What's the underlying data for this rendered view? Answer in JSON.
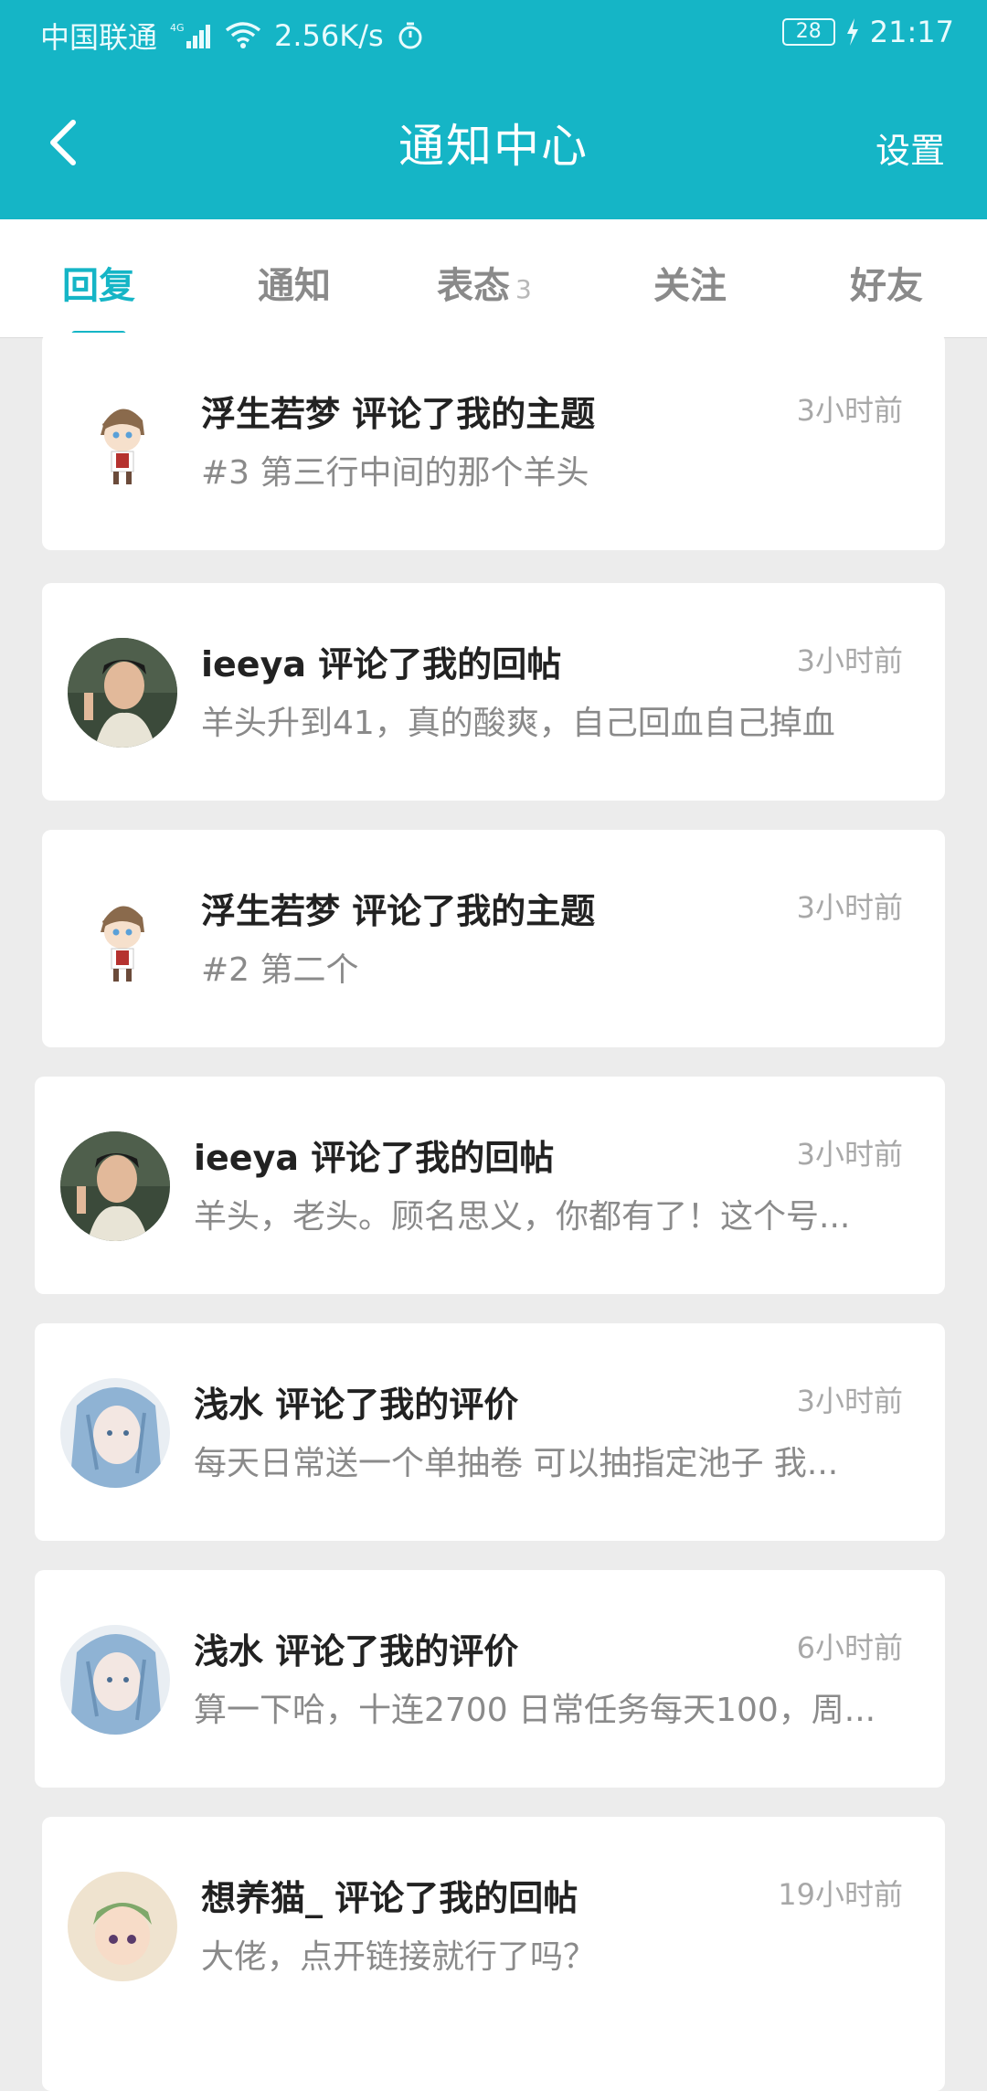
{
  "status_bar": {
    "carrier": "中国联通",
    "network": "4G",
    "speed": "2.56K/s",
    "battery": "28",
    "time": "21:17"
  },
  "header": {
    "title": "通知中心",
    "settings_label": "设置"
  },
  "tabs": [
    {
      "label": "回复",
      "badge": ""
    },
    {
      "label": "通知",
      "badge": ""
    },
    {
      "label": "表态",
      "badge": "3"
    },
    {
      "label": "关注",
      "badge": ""
    },
    {
      "label": "好友",
      "badge": ""
    }
  ],
  "notifications": [
    {
      "title": "浮生若梦 评论了我的主题",
      "snippet": "#3 第三行中间的那个羊头",
      "time": "3小时前",
      "avatar": "chibi-character-avatar"
    },
    {
      "title": "ieeya 评论了我的回帖",
      "snippet": "羊头升到41，真的酸爽，自己回血自己掉血",
      "time": "3小时前",
      "avatar": "man-photo-avatar"
    },
    {
      "title": "浮生若梦 评论了我的主题",
      "snippet": "#2 第二个",
      "time": "3小时前",
      "avatar": "chibi-character-avatar"
    },
    {
      "title": "ieeya 评论了我的回帖",
      "snippet": "羊头，老头。顾名思义，你都有了！这个号...",
      "time": "3小时前",
      "avatar": "man-photo-avatar"
    },
    {
      "title": "浅水 评论了我的评价",
      "snippet": "每天日常送一个单抽卷 可以抽指定池子 我...",
      "time": "3小时前",
      "avatar": "anime-blue-hair-avatar"
    },
    {
      "title": "浅水 评论了我的评价",
      "snippet": "算一下哈，十连2700 日常任务每天100，周...",
      "time": "6小时前",
      "avatar": "anime-blue-hair-avatar"
    },
    {
      "title": "想养猫_ 评论了我的回帖",
      "snippet": "大佬，点开链接就行了吗？",
      "time": "19小时前",
      "avatar": "anime-green-hair-avatar"
    }
  ],
  "colors": {
    "accent": "#15b5c6",
    "background": "#ececec"
  }
}
